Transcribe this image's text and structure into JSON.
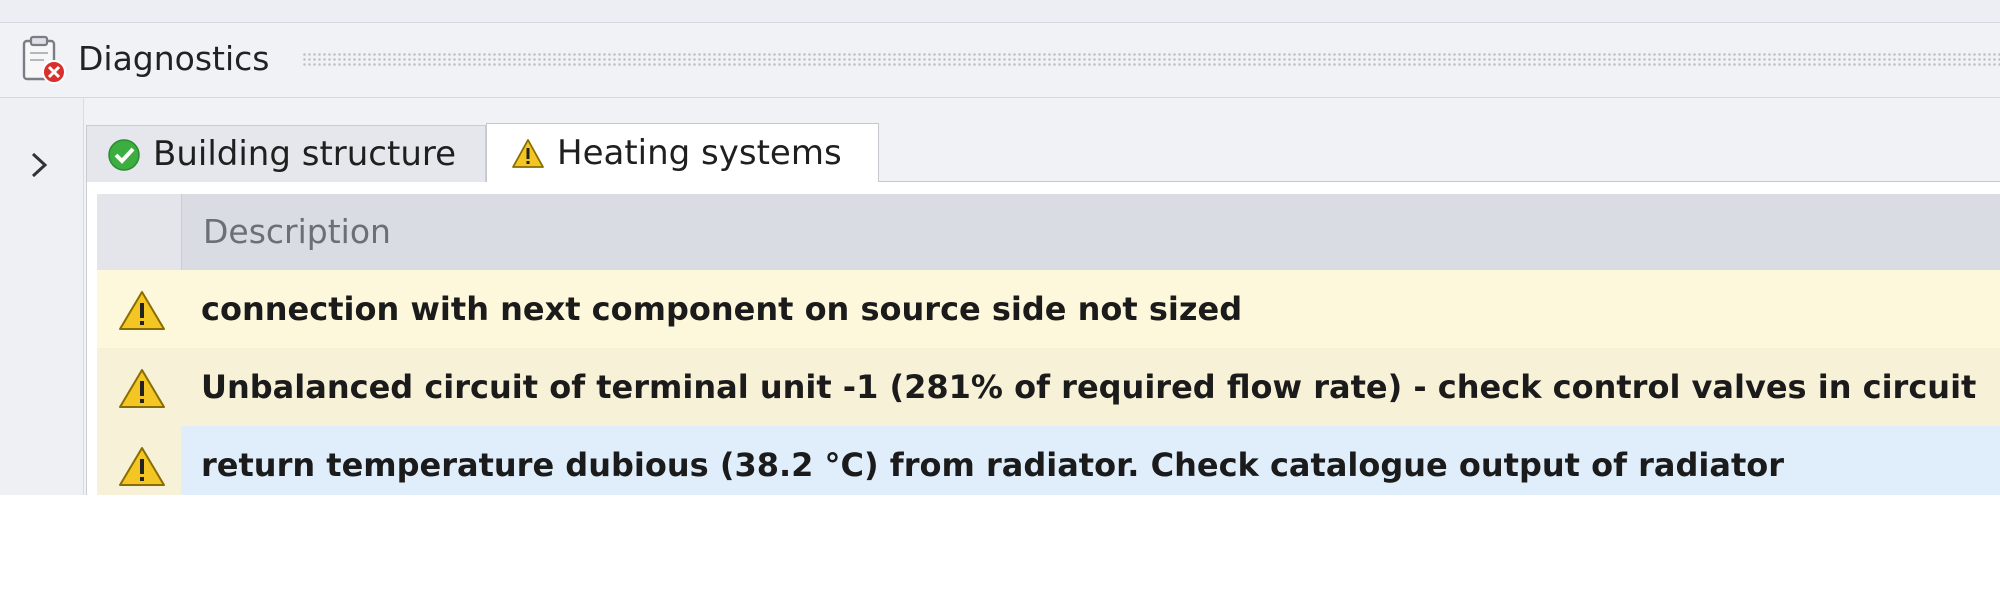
{
  "panel": {
    "title": "Diagnostics",
    "icon": "clipboard-error-icon"
  },
  "tabs": [
    {
      "label": "Building structure",
      "icon": "check-circle-icon",
      "status": "ok",
      "active": false
    },
    {
      "label": "Heating systems",
      "icon": "warning-triangle-icon",
      "status": "warning",
      "active": true
    }
  ],
  "grid": {
    "columns": [
      {
        "header": "Description"
      }
    ],
    "rows": [
      {
        "icon": "warning-triangle-icon",
        "description": "connection with next component on source side not sized",
        "background": "#fdf8dc"
      },
      {
        "icon": "warning-triangle-icon",
        "description": "Unbalanced circuit of terminal unit -1  (281% of required flow rate) - check control valves in circuit",
        "background": "#f7f1d8"
      },
      {
        "icon": "warning-triangle-icon",
        "description": "return temperature dubious (38.2 °C) from radiator. Check catalogue output of radiator",
        "background": "#dfeefa"
      }
    ]
  },
  "colors": {
    "warning": "#f3c623",
    "ok": "#3cae3f",
    "error": "#d9302c"
  }
}
